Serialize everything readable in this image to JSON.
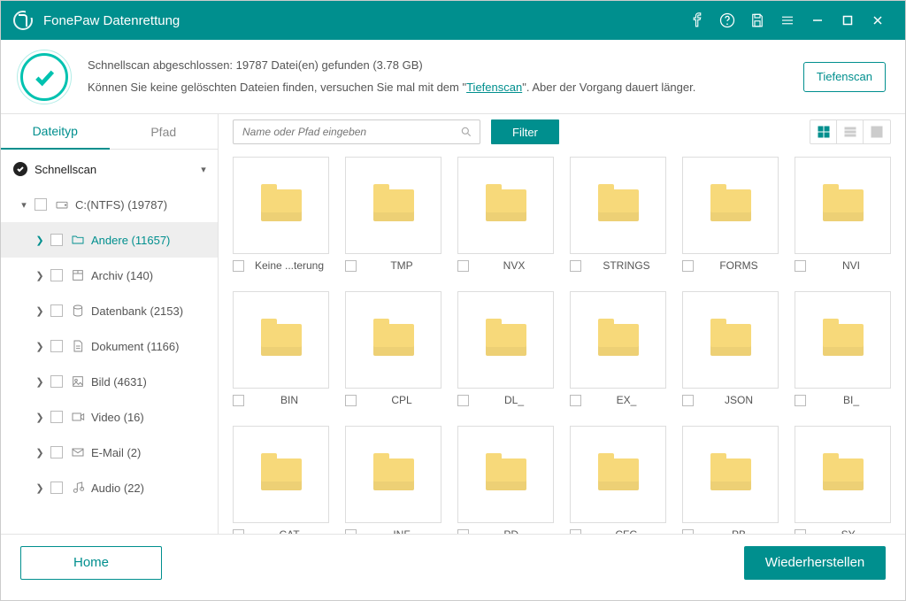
{
  "app_title": "FonePaw Datenrettung",
  "summary": {
    "line1": "Schnellscan abgeschlossen: 19787 Datei(en) gefunden (3.78 GB)",
    "line2_a": "Können Sie keine gelöschten Dateien finden, versuchen Sie mal mit dem \"",
    "line2_link": "Tiefenscan",
    "line2_b": "\". Aber der Vorgang dauert länger."
  },
  "deepscan_label": "Tiefenscan",
  "sidebar": {
    "tabs": {
      "filetype": "Dateityp",
      "path": "Pfad"
    },
    "quickscan": "Schnellscan",
    "drive": "C:(NTFS) (19787)",
    "categories": [
      {
        "label": "Andere (11657)",
        "selected": true,
        "icon": "folder"
      },
      {
        "label": "Archiv (140)",
        "icon": "archive"
      },
      {
        "label": "Datenbank (2153)",
        "icon": "db"
      },
      {
        "label": "Dokument (1166)",
        "icon": "doc"
      },
      {
        "label": "Bild (4631)",
        "icon": "image"
      },
      {
        "label": "Video (16)",
        "icon": "video"
      },
      {
        "label": "E-Mail (2)",
        "icon": "mail"
      },
      {
        "label": "Audio (22)",
        "icon": "audio"
      }
    ]
  },
  "search_placeholder": "Name oder Pfad eingeben",
  "filter_label": "Filter",
  "folders": [
    "Keine ...terung",
    "TMP",
    "NVX",
    "STRINGS",
    "FORMS",
    "NVI",
    "BIN",
    "CPL",
    "DL_",
    "EX_",
    "JSON",
    "BI_",
    "CAT",
    "INF",
    "PD_",
    "CFG",
    "PB",
    "SY_"
  ],
  "footer": {
    "home": "Home",
    "recover": "Wiederherstellen"
  }
}
